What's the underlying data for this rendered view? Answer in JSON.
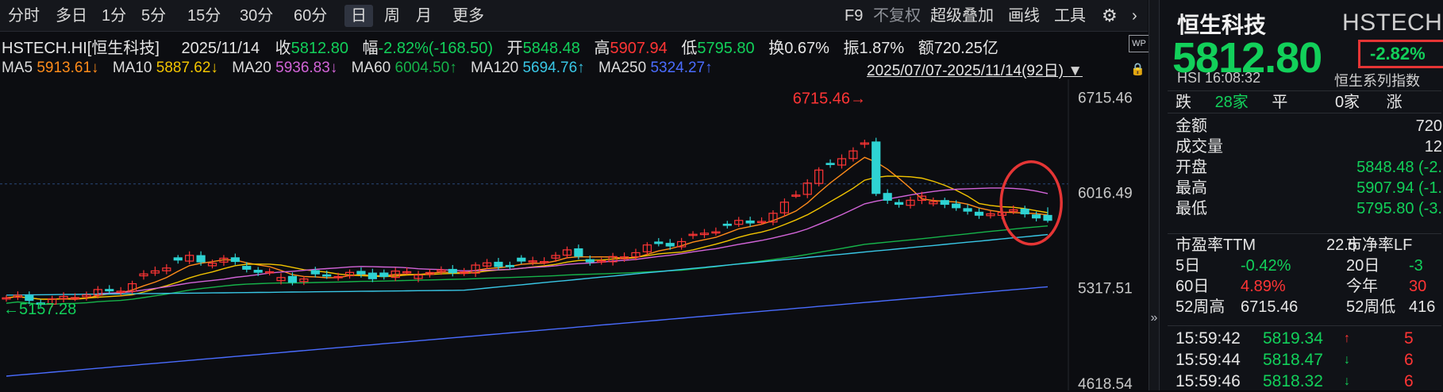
{
  "toolbar": {
    "periods": [
      "分时",
      "多日",
      "1分",
      "5分",
      "15分",
      "30分",
      "60分",
      "日",
      "周",
      "月",
      "更多"
    ],
    "active_period": "日",
    "right_tools": [
      "F9",
      "不复权",
      "超级叠加",
      "画线",
      "工具"
    ]
  },
  "info": {
    "symbol": "HSTECH.HI[恒生科技]",
    "date": "2025/11/14",
    "close_label": "收",
    "close": "5812.80",
    "change_label": "幅",
    "change": "-2.82%(-168.50)",
    "open_label": "开",
    "open": "5848.48",
    "high_label": "高",
    "high": "5907.94",
    "low_label": "低",
    "low": "5795.80",
    "turnover_label": "换",
    "turnover": "0.67%",
    "amplitude_label": "振",
    "amplitude": "1.87%",
    "amount_label": "额",
    "amount": "720.25亿",
    "wp_badge": "WP"
  },
  "ma": {
    "items": [
      {
        "label": "MA5",
        "value": "5913.61↓",
        "color": "#ff8c1a"
      },
      {
        "label": "MA10",
        "value": "5887.62↓",
        "color": "#f2c400"
      },
      {
        "label": "MA20",
        "value": "5936.83↓",
        "color": "#d264d8"
      },
      {
        "label": "MA60",
        "value": "6004.50↑",
        "color": "#16b34a"
      },
      {
        "label": "MA120",
        "value": "5694.76↑",
        "color": "#39c7e6"
      },
      {
        "label": "MA250",
        "value": "5324.27↑",
        "color": "#4a6cff"
      }
    ],
    "range": "2025/07/07-2025/11/14(92日)"
  },
  "chart": {
    "price_labels": [
      "6715.46",
      "6016.49",
      "5317.51",
      "4618.54"
    ],
    "high_marker": "6715.46→",
    "low_marker": "←5157.28"
  },
  "chart_data": {
    "type": "candlestick",
    "x": [
      "2025/07/07",
      "2025/11/14"
    ],
    "y_axis_ticks": [
      6715.46,
      6016.49,
      5317.51,
      4618.54
    ],
    "ylim": [
      4600,
      6800
    ],
    "period_high": 6715.46,
    "period_low": 5157.28,
    "last": {
      "open": 5848.48,
      "high": 5907.94,
      "low": 5795.8,
      "close": 5812.8
    },
    "moving_averages": {
      "MA5": 5913.61,
      "MA10": 5887.62,
      "MA20": 5936.83,
      "MA60": 6004.5,
      "MA120": 5694.76,
      "MA250": 5324.27
    },
    "colors": {
      "up": "#ff3535",
      "down": "#2ed3d3"
    }
  },
  "quote": {
    "name": "恒生科技",
    "code": "HSTECH",
    "price": "5812.80",
    "pct": "-2.82%",
    "sub_left": "HSI  16:08:32",
    "sub_right": "恒生系列指数",
    "breadth": {
      "down_label": "跌",
      "down_count": "28家",
      "flat_label": "平",
      "flat_count": "0家",
      "up_label": "涨"
    },
    "stats": [
      {
        "label": "金额",
        "value": "720"
      },
      {
        "label": "成交量",
        "value": "12"
      },
      {
        "label": "开盘",
        "value": "5848.48 (-2."
      },
      {
        "label": "最高",
        "value": "5907.94 (-1."
      },
      {
        "label": "最低",
        "value": "5795.80 (-3."
      }
    ],
    "valuation": {
      "pe_label": "市盈率TTM",
      "pe": "22.5",
      "pb_label": "市净率LF"
    },
    "perf": [
      {
        "l1": "5日",
        "v1": "-0.42%",
        "l2": "20日",
        "v2": "-3"
      },
      {
        "l1": "60日",
        "v1": "4.89%",
        "l2": "今年",
        "v2": "30"
      },
      {
        "l1": "52周高",
        "v1": "6715.46",
        "l2": "52周低",
        "v2": "416"
      }
    ],
    "ticks": [
      {
        "time": "15:59:42",
        "price": "5819.34",
        "dir": "up",
        "vol": "5"
      },
      {
        "time": "15:59:44",
        "price": "5818.47",
        "dir": "down",
        "vol": "6"
      },
      {
        "time": "15:59:46",
        "price": "5818.32",
        "dir": "down",
        "vol": "6"
      }
    ]
  }
}
